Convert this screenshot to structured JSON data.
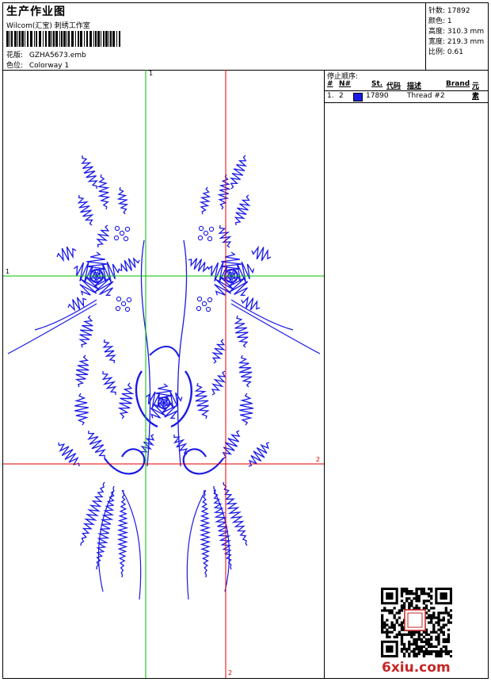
{
  "header": {
    "title": "生产作业图",
    "company": "Wilcom(汇宝) 刺绣工作室",
    "design_label": "花版:",
    "design_value": "GZHA5673.emb",
    "colorway_label": "色位:",
    "colorway_value": "Colorway 1"
  },
  "stats": {
    "stitches_label": "针数:",
    "stitches_value": "17892",
    "colors_label": "颜色:",
    "colors_value": "1",
    "height_label": "高度:",
    "height_value": "310.3 mm",
    "width_label": "宽度:",
    "width_value": "219.3 mm",
    "scale_label": "比例:",
    "scale_value": "0.61"
  },
  "sequence": {
    "title": "停止顺序:",
    "headers": {
      "num": "#",
      "needle": "N#",
      "stitches": "St.",
      "code": "代码",
      "desc": "描述",
      "brand": "Brand",
      "element": "元素"
    },
    "rows": [
      {
        "num": "1.",
        "needle": "2",
        "color": "#1a1ae6",
        "stitches": "17890",
        "desc": "Thread #2"
      }
    ]
  },
  "axis": {
    "green_top": "1",
    "green_left": "1",
    "red_right": "2",
    "red_bottom": "2"
  },
  "colors": {
    "thread": "#1a1ae6",
    "guide_green": "#00c000",
    "guide_red": "#e00000"
  },
  "watermark": {
    "text": "6xiu.com"
  }
}
